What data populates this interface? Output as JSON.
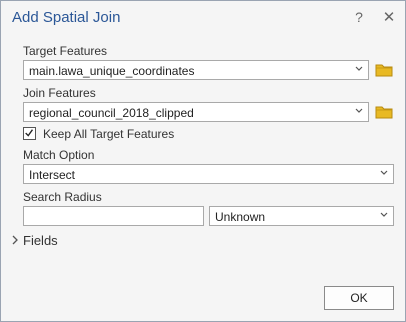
{
  "dialog": {
    "title": "Add Spatial Join",
    "help_glyph": "?",
    "close_glyph": "✕"
  },
  "target_features": {
    "label": "Target Features",
    "value": "main.lawa_unique_coordinates"
  },
  "join_features": {
    "label": "Join Features",
    "value": "regional_council_2018_clipped"
  },
  "keep_all": {
    "label": "Keep All Target Features",
    "checked": true
  },
  "match_option": {
    "label": "Match Option",
    "value": "Intersect"
  },
  "search_radius": {
    "label": "Search Radius",
    "value": "",
    "unit": "Unknown"
  },
  "fields": {
    "label": "Fields",
    "expanded": false
  },
  "buttons": {
    "ok": "OK"
  },
  "colors": {
    "title": "#2b5797",
    "folder": "#e8b923",
    "border": "#a9a9a9"
  }
}
